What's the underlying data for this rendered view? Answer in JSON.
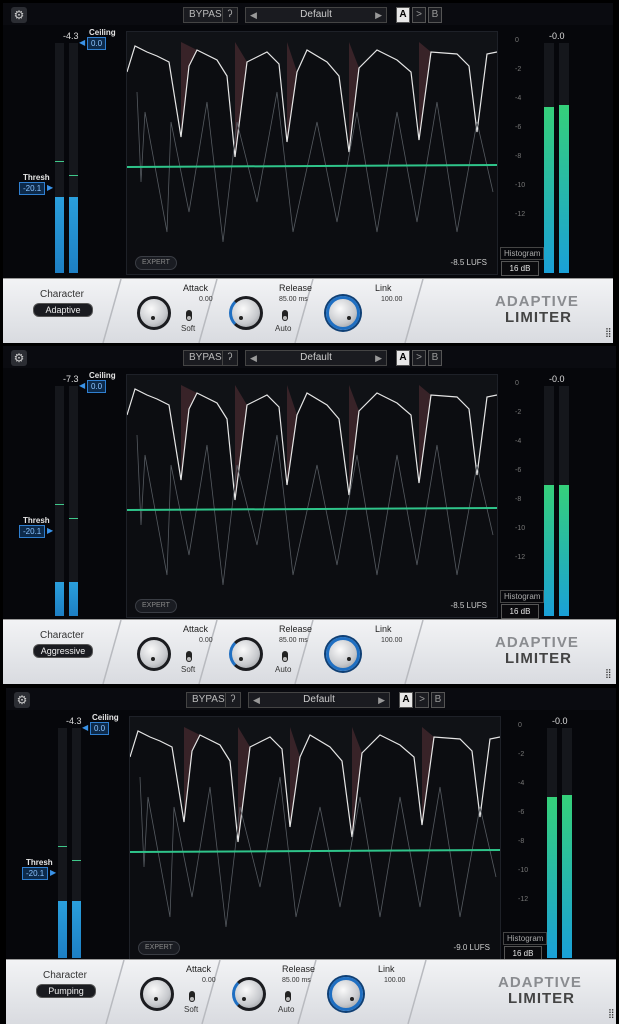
{
  "panels": [
    {
      "top": {
        "bypass_label": "BYPASS",
        "preset_name": "Default",
        "ab_a": "A",
        "ab_copy": ">",
        "ab_b": "B"
      },
      "input_meter": {
        "peak_label": "-4.3",
        "level": 0.33
      },
      "ceiling": {
        "label": "Ceiling",
        "value": "0.0"
      },
      "threshold": {
        "label": "Thresh",
        "value": "-20.1"
      },
      "graph": {
        "expert_label": "EXPERT",
        "lufs": "-8.5 LUFS"
      },
      "scale": [
        "0",
        "-2",
        "-4",
        "-6",
        "-8",
        "-10",
        "-12"
      ],
      "output_meter": {
        "peak_label": "-0.0",
        "level_l": 0.72,
        "level_r": 0.73
      },
      "histogram_label": "Histogram",
      "range_label": "16 dB",
      "character": {
        "label": "Character",
        "mode": "Adaptive"
      },
      "attack": {
        "label": "Attack",
        "value": "0.00",
        "toggle_label": "Soft"
      },
      "release": {
        "label": "Release",
        "value": "85.00 ms",
        "toggle_label": "Auto"
      },
      "link": {
        "label": "Link",
        "value": "100.00"
      },
      "brand": {
        "line1": "ADAPTIVE",
        "line2": "LIMITER"
      }
    },
    {
      "top": {
        "bypass_label": "BYPASS",
        "preset_name": "Default",
        "ab_a": "A",
        "ab_copy": ">",
        "ab_b": "B"
      },
      "input_meter": {
        "peak_label": "-7.3",
        "level": 0.15
      },
      "ceiling": {
        "label": "Ceiling",
        "value": "0.0"
      },
      "threshold": {
        "label": "Thresh",
        "value": "-20.1"
      },
      "graph": {
        "expert_label": "EXPERT",
        "lufs": "-8.5 LUFS"
      },
      "scale": [
        "0",
        "-2",
        "-4",
        "-6",
        "-8",
        "-10",
        "-12"
      ],
      "output_meter": {
        "peak_label": "-0.0",
        "level_l": 0.57,
        "level_r": 0.57
      },
      "histogram_label": "Histogram",
      "range_label": "16 dB",
      "character": {
        "label": "Character",
        "mode": "Aggressive"
      },
      "attack": {
        "label": "Attack",
        "value": "0.00",
        "toggle_label": "Soft"
      },
      "release": {
        "label": "Release",
        "value": "85.00 ms",
        "toggle_label": "Auto"
      },
      "link": {
        "label": "Link",
        "value": "100.00"
      },
      "brand": {
        "line1": "ADAPTIVE",
        "line2": "LIMITER"
      }
    },
    {
      "top": {
        "bypass_label": "BYPASS",
        "preset_name": "Default",
        "ab_a": "A",
        "ab_copy": ">",
        "ab_b": "B"
      },
      "input_meter": {
        "peak_label": "-4.3",
        "level": 0.25
      },
      "ceiling": {
        "label": "Ceiling",
        "value": "0.0"
      },
      "threshold": {
        "label": "Thresh",
        "value": "-20.1"
      },
      "graph": {
        "expert_label": "EXPERT",
        "lufs": "-9.0 LUFS"
      },
      "scale": [
        "0",
        "-2",
        "-4",
        "-6",
        "-8",
        "-10",
        "-12"
      ],
      "output_meter": {
        "peak_label": "-0.0",
        "level_l": 0.7,
        "level_r": 0.71
      },
      "histogram_label": "Histogram",
      "range_label": "16 dB",
      "character": {
        "label": "Character",
        "mode": "Pumping"
      },
      "attack": {
        "label": "Attack",
        "value": "0.00",
        "toggle_label": "Soft"
      },
      "release": {
        "label": "Release",
        "value": "85.00 ms",
        "toggle_label": "Auto"
      },
      "link": {
        "label": "Link",
        "value": "100.00"
      },
      "brand": {
        "line1": "ADAPTIVE",
        "line2": "LIMITER"
      }
    }
  ],
  "icons": {
    "settings": "gear-icon",
    "ear": "ear-icon",
    "prev": "triangle-left-icon",
    "next": "triangle-right-icon",
    "grip": "resize-grip-icon"
  },
  "colors": {
    "accent": "#1f6fc2",
    "meter_blue": "#2a9fdc",
    "meter_green": "#35d07a",
    "threshold_line": "#2fc48a",
    "gain_reduction": "#c05a5a"
  }
}
